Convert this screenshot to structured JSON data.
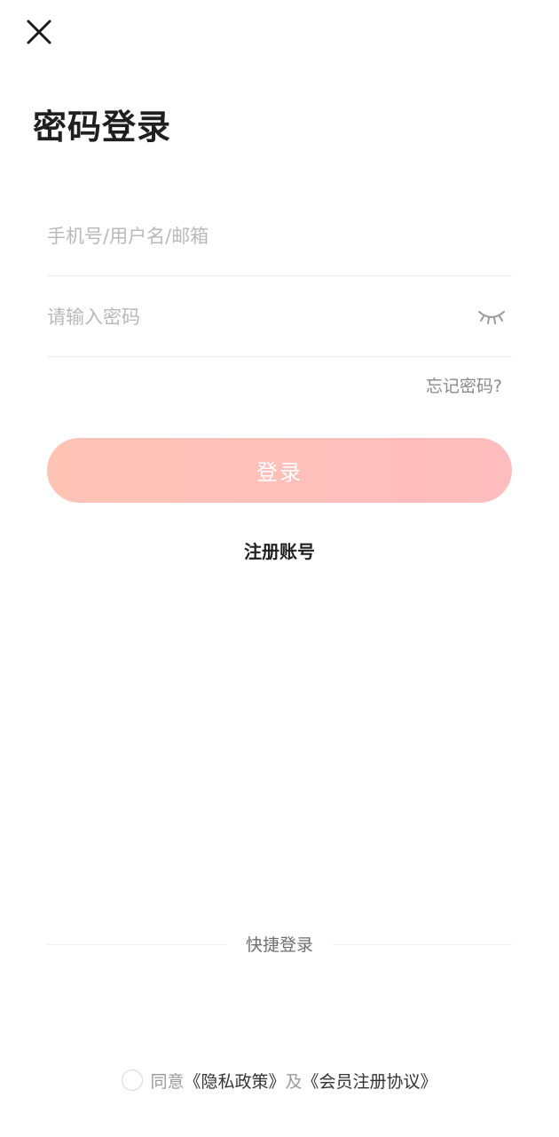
{
  "header": {
    "close_icon": "close-icon",
    "title": "密码登录"
  },
  "form": {
    "account_placeholder": "手机号/用户名/邮箱",
    "account_value": "",
    "password_placeholder": "请输入密码",
    "password_value": "",
    "password_toggle_icon": "eye-closed-icon",
    "forgot_label": "忘记密码?",
    "login_label": "登录",
    "register_label": "注册账号"
  },
  "quick_login": {
    "label": "快捷登录"
  },
  "agreement": {
    "checked": false,
    "prefix": "同意",
    "privacy_link": "《隐私政策》",
    "conjunction": "及",
    "member_link": "《会员注册协议》"
  },
  "colors": {
    "button_gradient_start": "#ffc3b6",
    "button_gradient_end": "#ffbdbf",
    "placeholder": "#b9b9b9",
    "divider": "#ececec"
  }
}
